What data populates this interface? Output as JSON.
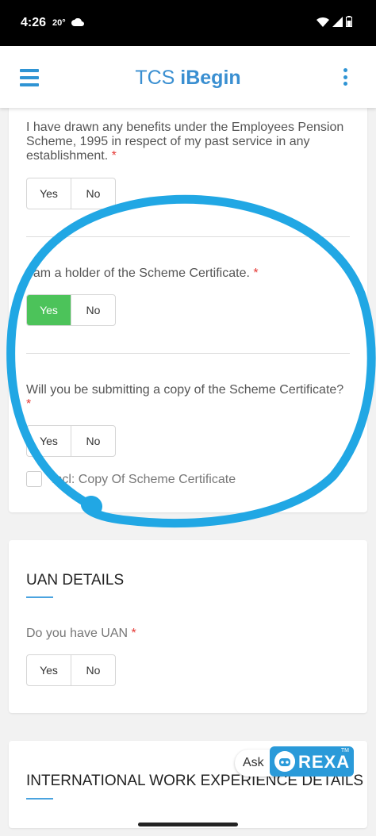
{
  "status": {
    "time": "4:26",
    "temp": "20°"
  },
  "appbar": {
    "title_prefix": "TCS ",
    "title_bold": "iBegin"
  },
  "questions": [
    {
      "text": "I have drawn any benefits under the Employees Pension Scheme, 1995 in respect of my past service in any establishment.",
      "required": "*",
      "yes": "Yes",
      "no": "No",
      "selected": "none"
    },
    {
      "text": "I am a holder of the Scheme Certificate.",
      "required": "*",
      "yes": "Yes",
      "no": "No",
      "selected": "Yes"
    },
    {
      "text": "Will you be submitting a copy of the Scheme Certificate?",
      "required": "*",
      "yes": "Yes",
      "no": "No",
      "selected": "none"
    }
  ],
  "checkbox": {
    "label": "Incl: Copy Of Scheme Certificate",
    "checked": false
  },
  "uan": {
    "title": "UAN DETAILS",
    "question": "Do you have UAN",
    "required": "*",
    "yes": "Yes",
    "no": "No",
    "selected": "none"
  },
  "intl": {
    "title": "INTERNATIONAL WORK EXPERIENCE DETAILS"
  },
  "rexa": {
    "ask": "Ask",
    "name": "REXA",
    "tm": "TM"
  },
  "colors": {
    "accent": "#2f94d4",
    "selected_green": "#4cc35a",
    "required_red": "#e53935",
    "annotation_blue": "#21a7e4"
  }
}
